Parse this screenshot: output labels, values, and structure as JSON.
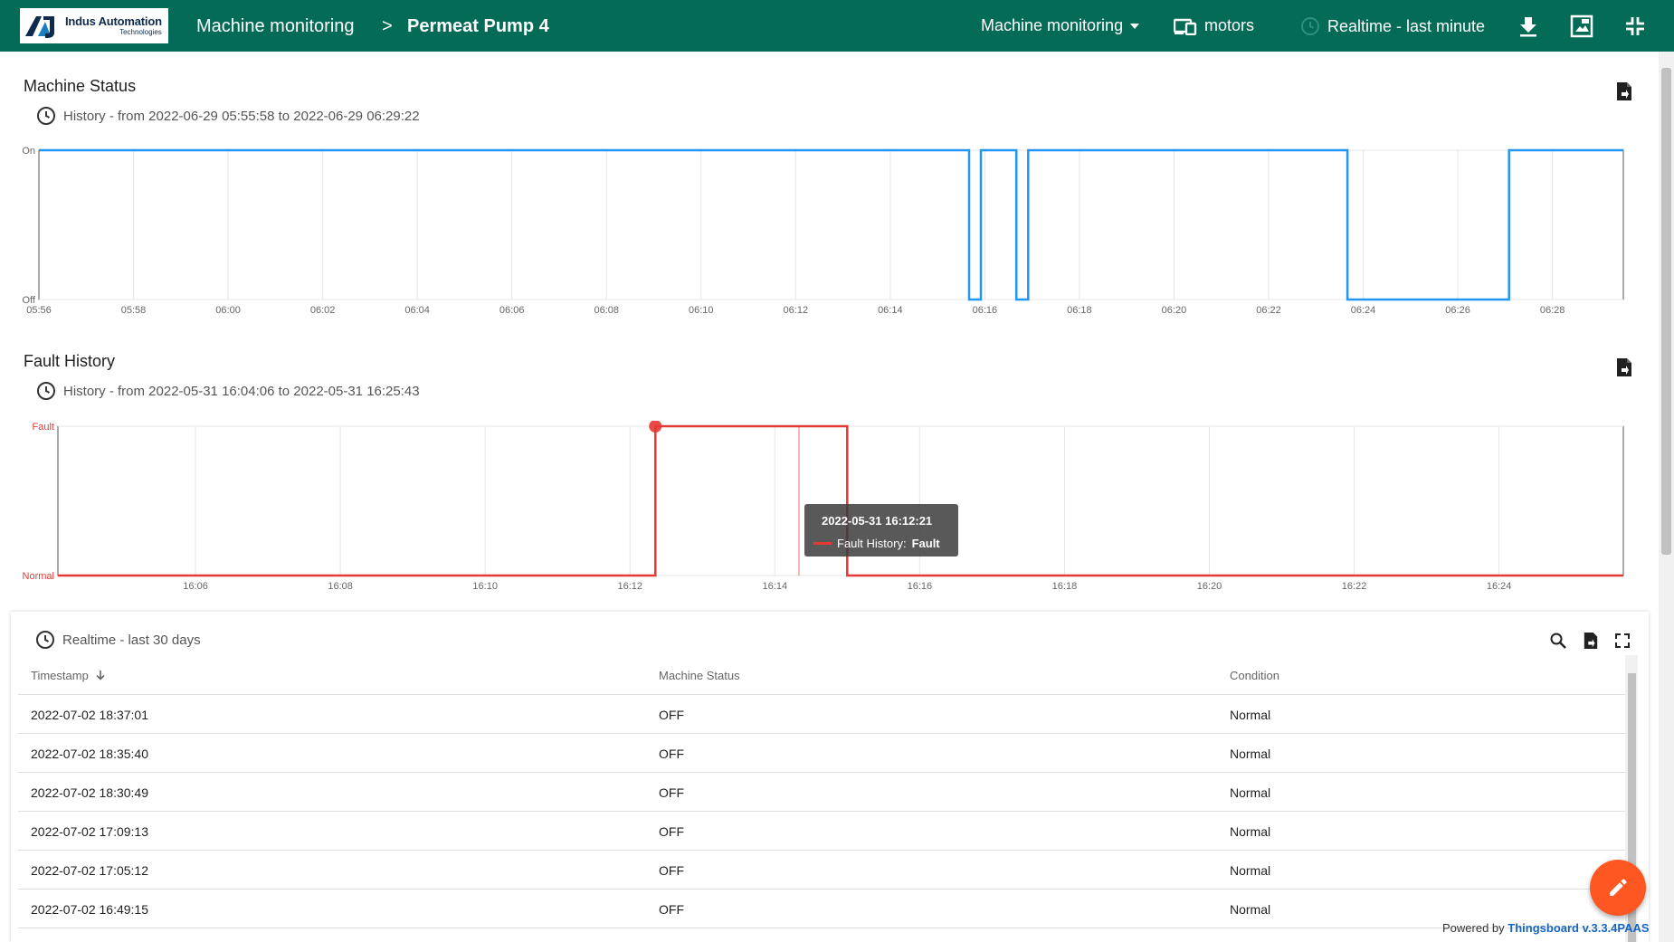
{
  "header": {
    "logo": {
      "name": "Indus Automation",
      "sub": "Technologies"
    },
    "breadcrumb": {
      "parent": "Machine monitoring",
      "separator": ">",
      "current": "Permeat Pump 4"
    },
    "dashboard_select": "Machine monitoring",
    "entity_label": "motors",
    "timewindow": "Realtime - last minute",
    "icons": [
      "chevron-down-icon",
      "devices-icon",
      "clock-icon",
      "download-icon",
      "export-image-icon",
      "fullscreen-exit-icon"
    ]
  },
  "colors": {
    "header": "#046b57",
    "status_line": "#2196f3",
    "fault_line": "#e53935",
    "fab": "#ff5722",
    "link": "#1565c0"
  },
  "machine_status": {
    "title": "Machine Status",
    "history": "History - from 2022-06-29 05:55:58 to 2022-06-29 06:29:22"
  },
  "fault_history": {
    "title": "Fault History",
    "history": "History - from 2022-05-31 16:04:06 to 2022-05-31 16:25:43",
    "tooltip": {
      "time": "2022-05-31 16:12:21",
      "series": "Fault History:",
      "value": "Fault"
    }
  },
  "chart_data": [
    {
      "type": "line",
      "title": "Machine Status",
      "xlabel": "",
      "ylabel": "",
      "x_ticks": [
        "05:56",
        "05:58",
        "06:00",
        "06:02",
        "06:04",
        "06:06",
        "06:08",
        "06:10",
        "06:12",
        "06:14",
        "06:16",
        "06:18",
        "06:20",
        "06:22",
        "06:24",
        "06:26",
        "06:28"
      ],
      "y_ticks": [
        "Off",
        "On"
      ],
      "x_range": [
        "05:56:00",
        "06:29:30"
      ],
      "grid": true,
      "step": true,
      "series": [
        {
          "color": "#2196f3",
          "points": [
            [
              "05:56:00",
              1
            ],
            [
              "06:15:40",
              1
            ],
            [
              "06:15:40",
              0
            ],
            [
              "06:15:55",
              0
            ],
            [
              "06:15:55",
              1
            ],
            [
              "06:16:40",
              1
            ],
            [
              "06:16:40",
              0
            ],
            [
              "06:16:55",
              0
            ],
            [
              "06:16:55",
              1
            ],
            [
              "06:23:40",
              1
            ],
            [
              "06:23:40",
              0
            ],
            [
              "06:27:05",
              0
            ],
            [
              "06:27:05",
              1
            ],
            [
              "06:29:30",
              1
            ]
          ]
        }
      ]
    },
    {
      "type": "line",
      "title": "Fault History",
      "xlabel": "",
      "ylabel": "",
      "x_ticks": [
        "16:06",
        "16:08",
        "16:10",
        "16:12",
        "16:14",
        "16:16",
        "16:18",
        "16:20",
        "16:22",
        "16:24"
      ],
      "y_ticks": [
        "Normal",
        "Fault"
      ],
      "x_range": [
        "16:04:06",
        "16:25:43"
      ],
      "grid": true,
      "step": true,
      "series": [
        {
          "color": "#e53935",
          "points": [
            [
              "16:04:06",
              0
            ],
            [
              "16:12:21",
              0
            ],
            [
              "16:12:21",
              1
            ],
            [
              "16:15:00",
              1
            ],
            [
              "16:15:00",
              0
            ],
            [
              "16:25:43",
              0
            ]
          ]
        }
      ],
      "highlight_point": [
        "16:12:21",
        1
      ],
      "crosshair_x": "16:14:20"
    }
  ],
  "table": {
    "timewindow": "Realtime - last 30 days",
    "columns": [
      "Timestamp",
      "Machine Status",
      "Condition"
    ],
    "rows": [
      [
        "2022-07-02 18:37:01",
        "OFF",
        "Normal"
      ],
      [
        "2022-07-02 18:35:40",
        "OFF",
        "Normal"
      ],
      [
        "2022-07-02 18:30:49",
        "OFF",
        "Normal"
      ],
      [
        "2022-07-02 17:09:13",
        "OFF",
        "Normal"
      ],
      [
        "2022-07-02 17:05:12",
        "OFF",
        "Normal"
      ],
      [
        "2022-07-02 16:49:15",
        "OFF",
        "Normal"
      ]
    ]
  },
  "footer": {
    "powered_prefix": "Powered by",
    "powered_link": "Thingsboard v.3.3.4PAAS"
  }
}
